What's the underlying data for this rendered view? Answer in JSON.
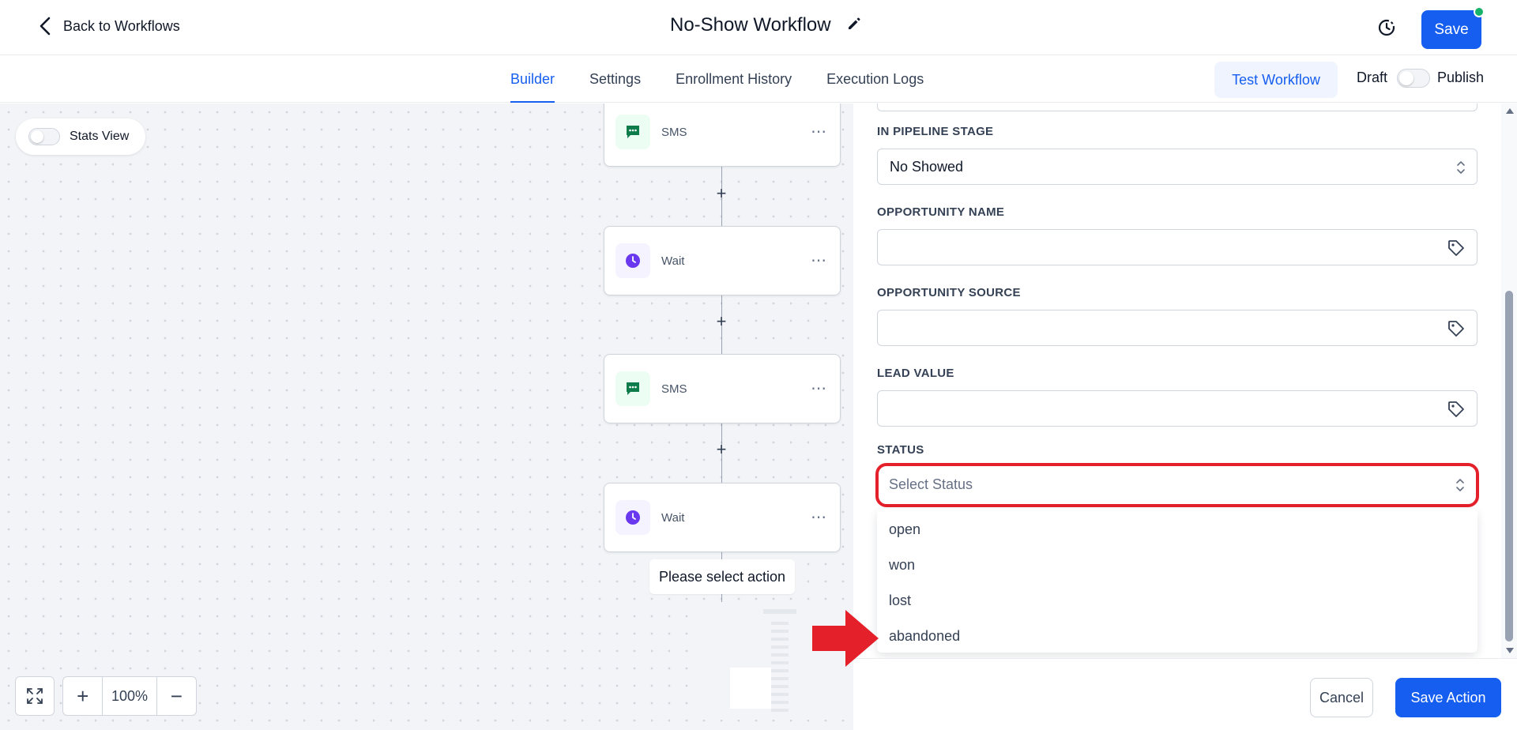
{
  "header": {
    "back_label": "Back to Workflows",
    "title": "No-Show Workflow",
    "save_label": "Save"
  },
  "tabs": [
    {
      "label": "Builder",
      "active": true
    },
    {
      "label": "Settings",
      "active": false
    },
    {
      "label": "Enrollment History",
      "active": false
    },
    {
      "label": "Execution Logs",
      "active": false
    }
  ],
  "toolbar": {
    "test_label": "Test Workflow",
    "draft_label": "Draft",
    "publish_label": "Publish",
    "publish_on": false
  },
  "canvas": {
    "stats_label": "Stats View",
    "nodes": [
      {
        "type": "SMS",
        "icon": "chat-icon"
      },
      {
        "type": "Wait",
        "icon": "clock-icon"
      },
      {
        "type": "SMS",
        "icon": "chat-icon"
      },
      {
        "type": "Wait",
        "icon": "clock-icon"
      }
    ],
    "select_action_label": "Please select action",
    "zoom_level": "100%"
  },
  "panel": {
    "pipeline_stage": {
      "label": "IN PIPELINE STAGE",
      "value": "No Showed"
    },
    "opportunity_name": {
      "label": "OPPORTUNITY NAME",
      "value": ""
    },
    "opportunity_source": {
      "label": "OPPORTUNITY SOURCE",
      "value": ""
    },
    "lead_value": {
      "label": "LEAD VALUE",
      "value": ""
    },
    "status": {
      "label": "STATUS",
      "placeholder": "Select Status",
      "options": [
        "open",
        "won",
        "lost",
        "abandoned"
      ]
    },
    "cancel_label": "Cancel",
    "save_action_label": "Save Action"
  },
  "colors": {
    "accent": "#155eef",
    "annotation": "#e4202a",
    "sms_icon": "#0e7c4a",
    "wait_icon": "#6938ef"
  }
}
